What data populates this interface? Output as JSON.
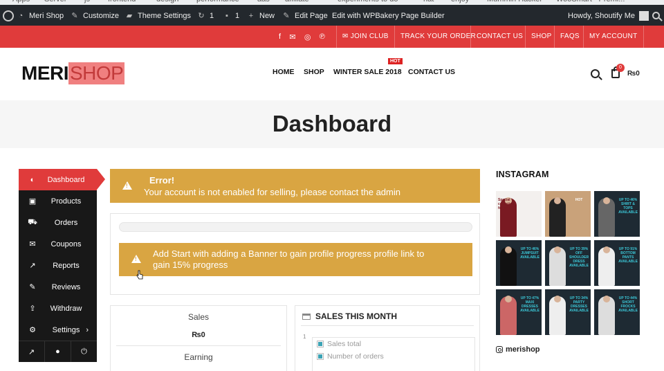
{
  "bookmarks": [
    "Apps",
    "Server",
    "js",
    "frontend",
    "design",
    "performance",
    "aas",
    "affiliate",
    "experiments to do",
    "nat",
    "enjoy",
    "Mummin Hacker",
    "WooSmart - Premi..."
  ],
  "admin_bar": {
    "site_name": "Meri Shop",
    "customize": "Customize",
    "theme_settings": "Theme Settings",
    "updates_count": "1",
    "comments_count": "1",
    "new": "New",
    "edit_page": "Edit Page",
    "wpbakery": "Edit with WPBakery Page Builder",
    "howdy": "Howdy, Shoutify Me"
  },
  "top_bar": {
    "links": [
      "JOIN CLUB",
      "TRACK YOUR ORDER",
      "CONTACT US",
      "SHOP",
      "FAQS",
      "MY ACCOUNT"
    ],
    "social_icons": [
      "facebook-icon",
      "mail-icon",
      "instagram-icon",
      "pinterest-icon"
    ]
  },
  "logo": {
    "part1": "MERI",
    "part2": "SHOP"
  },
  "nav": {
    "items": [
      "HOME",
      "SHOP",
      "WINTER SALE 2018",
      "CONTACT US"
    ],
    "hot_badge": "HOT"
  },
  "cart": {
    "count": "0",
    "total": "₨0"
  },
  "page_title": "Dashboard",
  "sidebar": {
    "items": [
      {
        "label": "Dashboard",
        "icon": "dashboard-icon",
        "glyph": "◐"
      },
      {
        "label": "Products",
        "icon": "briefcase-icon",
        "glyph": "▣"
      },
      {
        "label": "Orders",
        "icon": "cart-icon",
        "glyph": "⛟"
      },
      {
        "label": "Coupons",
        "icon": "gift-icon",
        "glyph": "✉"
      },
      {
        "label": "Reports",
        "icon": "chart-icon",
        "glyph": "↗"
      },
      {
        "label": "Reviews",
        "icon": "comments-icon",
        "glyph": "✎"
      },
      {
        "label": "Withdraw",
        "icon": "upload-icon",
        "glyph": "⇪"
      },
      {
        "label": "Settings",
        "icon": "gear-icon",
        "glyph": "⚙"
      }
    ],
    "footer_glyphs": [
      "↗",
      "●",
      "⏻"
    ]
  },
  "error": {
    "title": "Error!",
    "message": "Your account is not enabled for selling, please contact the admin"
  },
  "progress": {
    "percent": 0,
    "notice": "Add Start with adding a Banner to gain profile progress profile link to gain 15% progress"
  },
  "sales": {
    "sales_label": "Sales",
    "sales_value": "₨0",
    "earning_label": "Earning"
  },
  "sales_month": {
    "title": "SALES THIS MONTH",
    "y_tick": "1",
    "legend": [
      {
        "label": "Sales total",
        "color": "#3ba3b5"
      },
      {
        "label": "Number of orders",
        "color": "#3ba3b5"
      }
    ]
  },
  "instagram": {
    "title": "INSTAGRAM",
    "handle": "merishop",
    "tiles": [
      {
        "bg": "#f3f0ee",
        "fig": "#7a1a22",
        "tag": "Special collection for girls"
      },
      {
        "bg": "#c9a27a",
        "fig": "#222",
        "tag": "HOT"
      },
      {
        "bg": "#1e2a33",
        "fig": "#666",
        "tag": "UP TO 46% SHIRT & TOPS AVAILABLE"
      },
      {
        "bg": "#1e2a33",
        "fig": "#111",
        "tag": "UP TO 46% JUMPSUIT AVAILABLE"
      },
      {
        "bg": "#1e2a33",
        "fig": "#ddd",
        "tag": "UP TO 39% OFF SHOULDER DRESS AVAILABLE"
      },
      {
        "bg": "#1e2a33",
        "fig": "#eee",
        "tag": "UP TO 91% BOTTOM PANTS AVAILABLE"
      },
      {
        "bg": "#1e2a33",
        "fig": "#c66",
        "tag": "UP TO 47% MAXI DRESSES AVAILABLE"
      },
      {
        "bg": "#1e2a33",
        "fig": "#eee",
        "tag": "UP TO 34% PARTY DRESSES AVAILABLE"
      },
      {
        "bg": "#1e2a33",
        "fig": "#ddd",
        "tag": "UP TO 44% SHORT FROCKS AVAILABLE"
      }
    ]
  },
  "colors": {
    "brand_red": "#e03b3b",
    "warning": "#d9a542",
    "admin_bar": "#23282d",
    "accent_teal": "#3ba3b5"
  }
}
